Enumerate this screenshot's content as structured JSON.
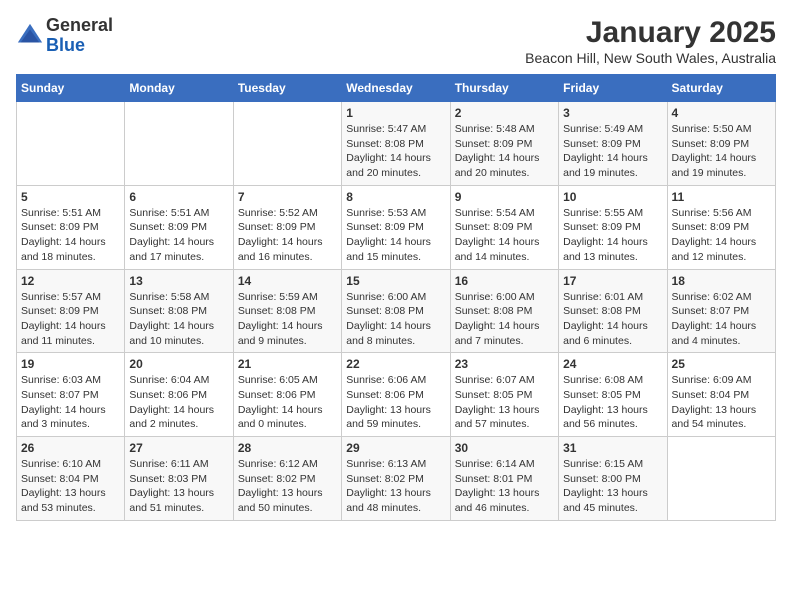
{
  "logo": {
    "text_general": "General",
    "text_blue": "Blue"
  },
  "title": "January 2025",
  "subtitle": "Beacon Hill, New South Wales, Australia",
  "days_of_week": [
    "Sunday",
    "Monday",
    "Tuesday",
    "Wednesday",
    "Thursday",
    "Friday",
    "Saturday"
  ],
  "weeks": [
    [
      {
        "day": "",
        "info": ""
      },
      {
        "day": "",
        "info": ""
      },
      {
        "day": "",
        "info": ""
      },
      {
        "day": "1",
        "info": "Sunrise: 5:47 AM\nSunset: 8:08 PM\nDaylight: 14 hours\nand 20 minutes."
      },
      {
        "day": "2",
        "info": "Sunrise: 5:48 AM\nSunset: 8:09 PM\nDaylight: 14 hours\nand 20 minutes."
      },
      {
        "day": "3",
        "info": "Sunrise: 5:49 AM\nSunset: 8:09 PM\nDaylight: 14 hours\nand 19 minutes."
      },
      {
        "day": "4",
        "info": "Sunrise: 5:50 AM\nSunset: 8:09 PM\nDaylight: 14 hours\nand 19 minutes."
      }
    ],
    [
      {
        "day": "5",
        "info": "Sunrise: 5:51 AM\nSunset: 8:09 PM\nDaylight: 14 hours\nand 18 minutes."
      },
      {
        "day": "6",
        "info": "Sunrise: 5:51 AM\nSunset: 8:09 PM\nDaylight: 14 hours\nand 17 minutes."
      },
      {
        "day": "7",
        "info": "Sunrise: 5:52 AM\nSunset: 8:09 PM\nDaylight: 14 hours\nand 16 minutes."
      },
      {
        "day": "8",
        "info": "Sunrise: 5:53 AM\nSunset: 8:09 PM\nDaylight: 14 hours\nand 15 minutes."
      },
      {
        "day": "9",
        "info": "Sunrise: 5:54 AM\nSunset: 8:09 PM\nDaylight: 14 hours\nand 14 minutes."
      },
      {
        "day": "10",
        "info": "Sunrise: 5:55 AM\nSunset: 8:09 PM\nDaylight: 14 hours\nand 13 minutes."
      },
      {
        "day": "11",
        "info": "Sunrise: 5:56 AM\nSunset: 8:09 PM\nDaylight: 14 hours\nand 12 minutes."
      }
    ],
    [
      {
        "day": "12",
        "info": "Sunrise: 5:57 AM\nSunset: 8:09 PM\nDaylight: 14 hours\nand 11 minutes."
      },
      {
        "day": "13",
        "info": "Sunrise: 5:58 AM\nSunset: 8:08 PM\nDaylight: 14 hours\nand 10 minutes."
      },
      {
        "day": "14",
        "info": "Sunrise: 5:59 AM\nSunset: 8:08 PM\nDaylight: 14 hours\nand 9 minutes."
      },
      {
        "day": "15",
        "info": "Sunrise: 6:00 AM\nSunset: 8:08 PM\nDaylight: 14 hours\nand 8 minutes."
      },
      {
        "day": "16",
        "info": "Sunrise: 6:00 AM\nSunset: 8:08 PM\nDaylight: 14 hours\nand 7 minutes."
      },
      {
        "day": "17",
        "info": "Sunrise: 6:01 AM\nSunset: 8:08 PM\nDaylight: 14 hours\nand 6 minutes."
      },
      {
        "day": "18",
        "info": "Sunrise: 6:02 AM\nSunset: 8:07 PM\nDaylight: 14 hours\nand 4 minutes."
      }
    ],
    [
      {
        "day": "19",
        "info": "Sunrise: 6:03 AM\nSunset: 8:07 PM\nDaylight: 14 hours\nand 3 minutes."
      },
      {
        "day": "20",
        "info": "Sunrise: 6:04 AM\nSunset: 8:06 PM\nDaylight: 14 hours\nand 2 minutes."
      },
      {
        "day": "21",
        "info": "Sunrise: 6:05 AM\nSunset: 8:06 PM\nDaylight: 14 hours\nand 0 minutes."
      },
      {
        "day": "22",
        "info": "Sunrise: 6:06 AM\nSunset: 8:06 PM\nDaylight: 13 hours\nand 59 minutes."
      },
      {
        "day": "23",
        "info": "Sunrise: 6:07 AM\nSunset: 8:05 PM\nDaylight: 13 hours\nand 57 minutes."
      },
      {
        "day": "24",
        "info": "Sunrise: 6:08 AM\nSunset: 8:05 PM\nDaylight: 13 hours\nand 56 minutes."
      },
      {
        "day": "25",
        "info": "Sunrise: 6:09 AM\nSunset: 8:04 PM\nDaylight: 13 hours\nand 54 minutes."
      }
    ],
    [
      {
        "day": "26",
        "info": "Sunrise: 6:10 AM\nSunset: 8:04 PM\nDaylight: 13 hours\nand 53 minutes."
      },
      {
        "day": "27",
        "info": "Sunrise: 6:11 AM\nSunset: 8:03 PM\nDaylight: 13 hours\nand 51 minutes."
      },
      {
        "day": "28",
        "info": "Sunrise: 6:12 AM\nSunset: 8:02 PM\nDaylight: 13 hours\nand 50 minutes."
      },
      {
        "day": "29",
        "info": "Sunrise: 6:13 AM\nSunset: 8:02 PM\nDaylight: 13 hours\nand 48 minutes."
      },
      {
        "day": "30",
        "info": "Sunrise: 6:14 AM\nSunset: 8:01 PM\nDaylight: 13 hours\nand 46 minutes."
      },
      {
        "day": "31",
        "info": "Sunrise: 6:15 AM\nSunset: 8:00 PM\nDaylight: 13 hours\nand 45 minutes."
      },
      {
        "day": "",
        "info": ""
      }
    ]
  ]
}
